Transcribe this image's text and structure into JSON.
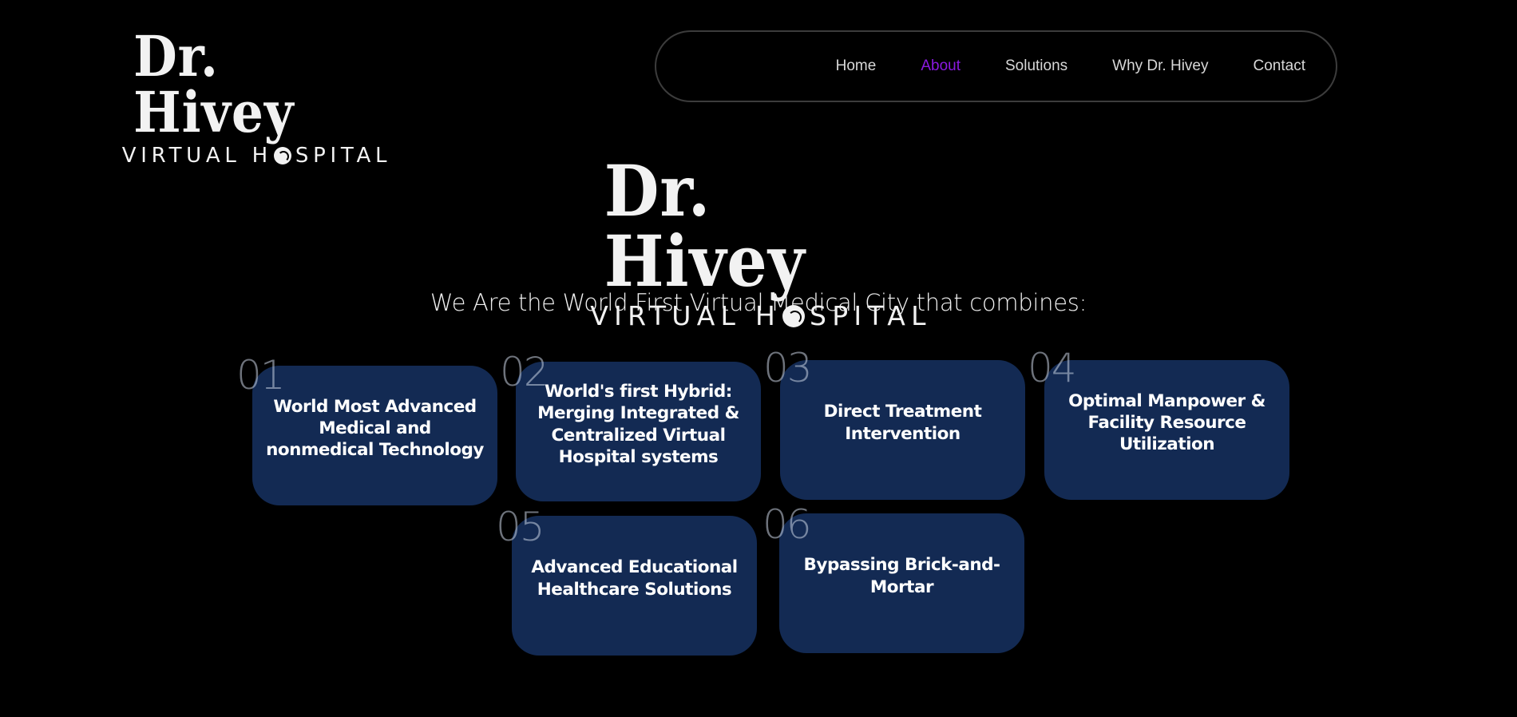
{
  "brand": {
    "name": "Dr. Hivey",
    "sub_before_o": "VIRTUAL H",
    "sub_after_o": "SPITAL",
    "full_sub": "VIRTUAL HOSPITAL"
  },
  "nav": {
    "items": [
      {
        "label": "Home",
        "active": false
      },
      {
        "label": "About",
        "active": true
      },
      {
        "label": "Solutions",
        "active": false
      },
      {
        "label": "Why Dr. Hivey",
        "active": false
      },
      {
        "label": "Contact",
        "active": false
      }
    ],
    "active_color": "#8a19e0"
  },
  "hero": {
    "tagline": "We Are the World First Virtual Medical City that combines:"
  },
  "features": [
    {
      "number": "01",
      "title": "World Most Advanced Medical and nonmedical Technology"
    },
    {
      "number": "02",
      "title": "World's first Hybrid: Merging Integrated & Centralized Virtual Hospital systems"
    },
    {
      "number": "03",
      "title": "Direct Treatment Intervention"
    },
    {
      "number": "04",
      "title": "Optimal Manpower & Facility Resource Utilization"
    },
    {
      "number": "05",
      "title": "Advanced Educational Healthcare Solutions"
    },
    {
      "number": "06",
      "title": "Bypassing Brick-and-Mortar"
    }
  ],
  "colors": {
    "background": "#000000",
    "card": "#132a53",
    "accent": "#8a19e0"
  }
}
